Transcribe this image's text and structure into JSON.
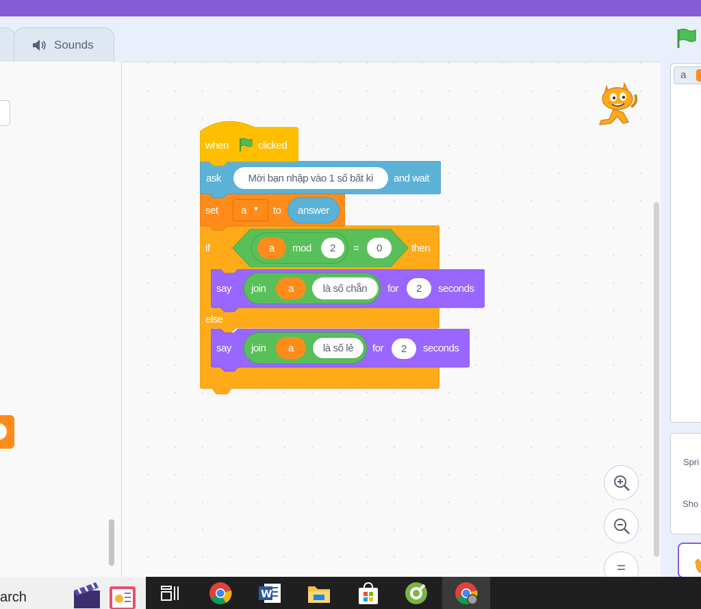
{
  "tabs": {
    "sounds_label": "Sounds"
  },
  "script": {
    "hat": {
      "when": "when",
      "clicked": "clicked"
    },
    "ask": {
      "label": "ask",
      "question": "Mời bạn nhập vào 1 số bất kì",
      "wait": "and wait"
    },
    "set": {
      "label": "set",
      "variable": "a",
      "to": "to",
      "value": "answer"
    },
    "if": {
      "label": "if",
      "variable": "a",
      "mod": "mod",
      "divisor": "2",
      "equals": "=",
      "compare": "0",
      "then": "then"
    },
    "say_even": {
      "label": "say",
      "join": "join",
      "variable": "a",
      "text": "là số chẵn",
      "for": "for",
      "secs": "2",
      "seconds": "seconds"
    },
    "else": {
      "label": "else"
    },
    "say_odd": {
      "label": "say",
      "join": "join",
      "variable": "a",
      "text": "là số lẻ",
      "for": "for",
      "secs": "2",
      "seconds": "seconds"
    }
  },
  "stage": {
    "monitor_label": "a",
    "sprite_label": "Spri",
    "show_label": "Sho"
  },
  "zoom": {
    "reset_label": "="
  },
  "taskbar": {
    "search_text": "arch"
  },
  "colors": {
    "events": "#ffbf00",
    "sensing": "#5cb1d6",
    "variables": "#ff8c1a",
    "control": "#ffab19",
    "operators": "#59c059",
    "looks": "#9966ff",
    "menu_bar": "#855cd6"
  }
}
